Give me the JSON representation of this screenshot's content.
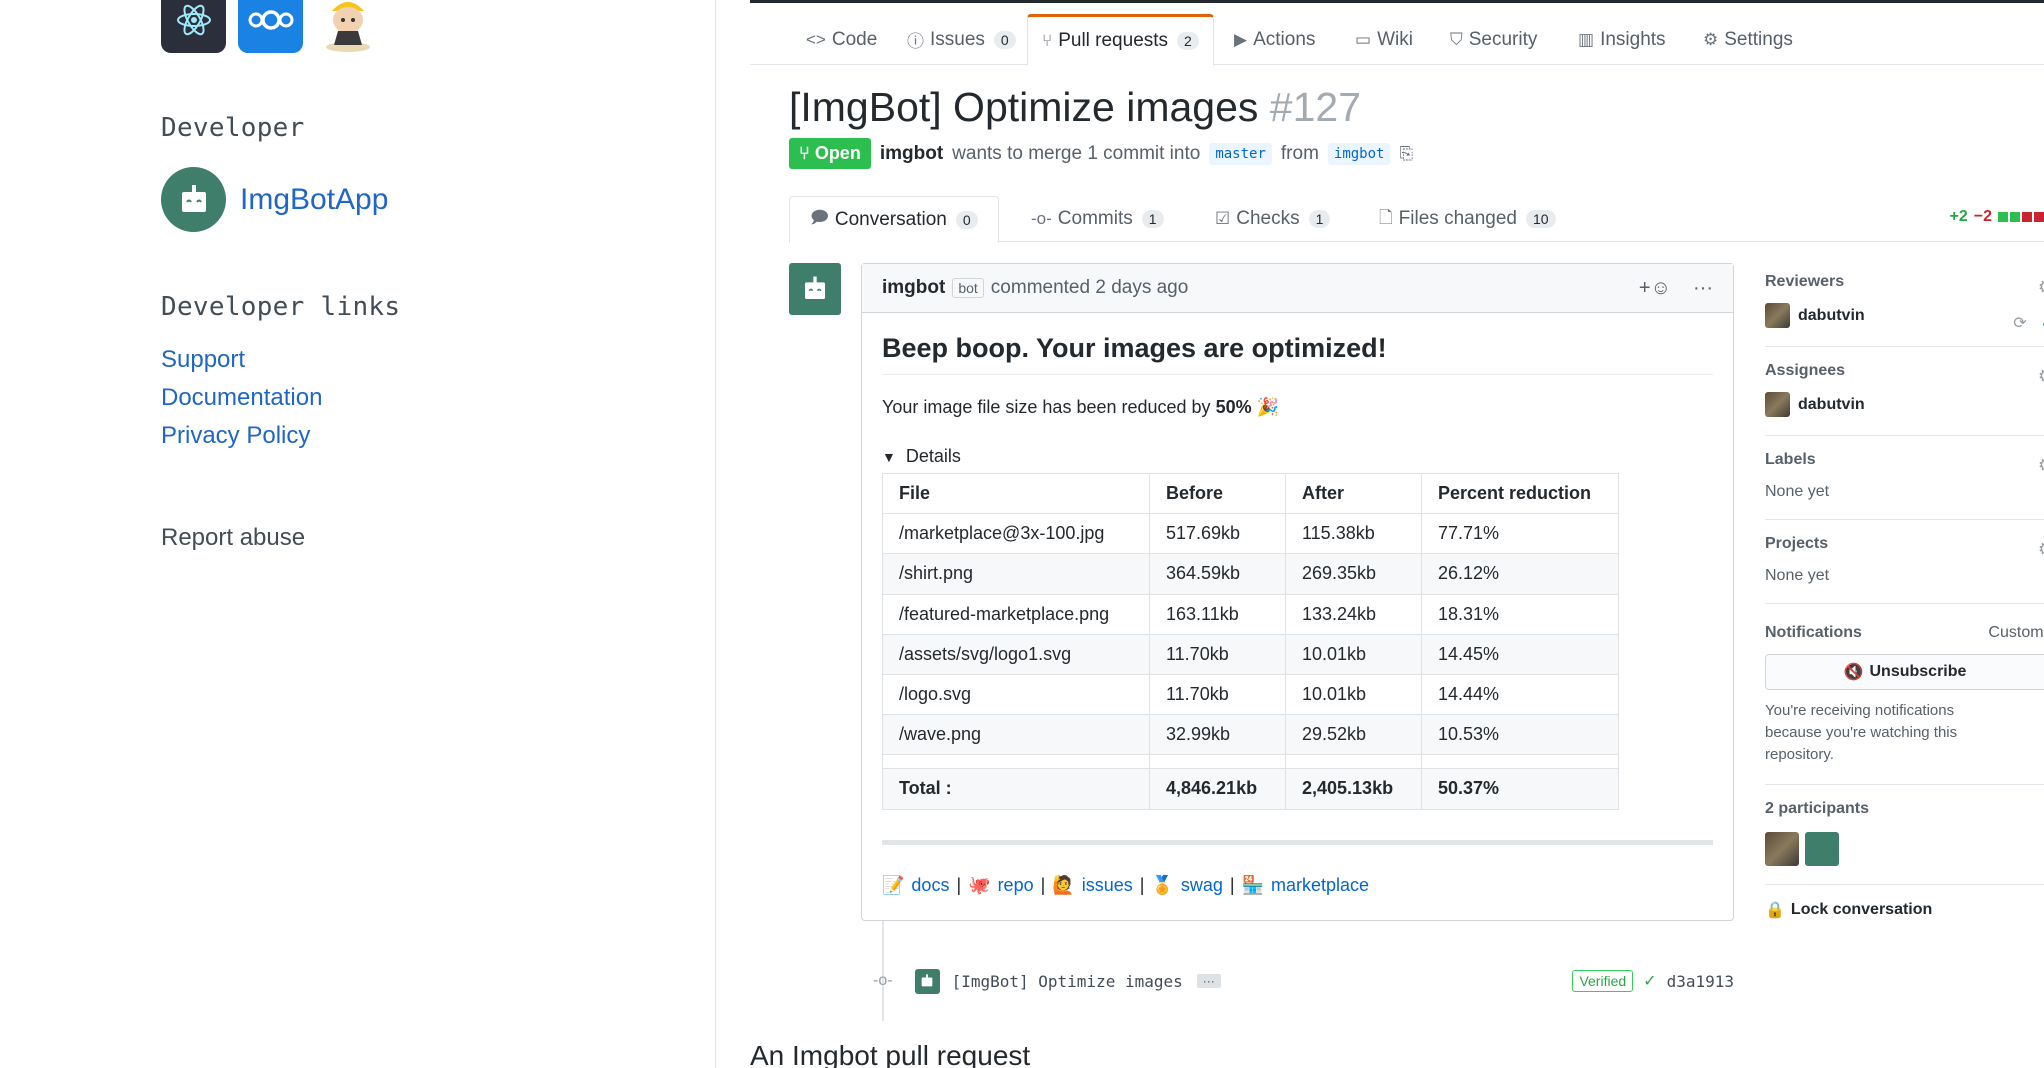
{
  "left": {
    "developer_heading": "Developer",
    "developer_name": "ImgBotApp",
    "links_heading": "Developer links",
    "links": [
      "Support",
      "Documentation",
      "Privacy Policy"
    ],
    "report": "Report abuse"
  },
  "repo_tabs": [
    {
      "label": "Code",
      "icon": "code-icon"
    },
    {
      "label": "Issues",
      "count": "0",
      "icon": "issue-icon"
    },
    {
      "label": "Pull requests",
      "count": "2",
      "icon": "pull-request-icon"
    },
    {
      "label": "Actions",
      "icon": "play-icon"
    },
    {
      "label": "Wiki",
      "icon": "book-icon"
    },
    {
      "label": "Security",
      "icon": "shield-icon"
    },
    {
      "label": "Insights",
      "icon": "graph-icon"
    },
    {
      "label": "Settings",
      "icon": "gear-icon"
    }
  ],
  "pr": {
    "title": "[ImgBot] Optimize images",
    "number": "#127",
    "state": "Open",
    "author": "imgbot",
    "merge_text": "wants to merge 1 commit into",
    "base_branch": "master",
    "from_text": "from",
    "head_branch": "imgbot"
  },
  "pr_tabs": [
    {
      "label": "Conversation",
      "count": "0"
    },
    {
      "label": "Commits",
      "count": "1"
    },
    {
      "label": "Checks",
      "count": "1"
    },
    {
      "label": "Files changed",
      "count": "10"
    }
  ],
  "diffstat": {
    "additions": "+2",
    "deletions": "−2"
  },
  "comment": {
    "author": "imgbot",
    "badge": "bot",
    "time": "commented 2 days ago",
    "heading": "Beep boop. Your images are optimized!",
    "summary_prefix": "Your image file size has been reduced by",
    "summary_value": "50%",
    "details_label": "Details",
    "table": {
      "headers": [
        "File",
        "Before",
        "After",
        "Percent reduction"
      ],
      "rows": [
        [
          "/marketplace@3x-100.jpg",
          "517.69kb",
          "115.38kb",
          "77.71%"
        ],
        [
          "/shirt.png",
          "364.59kb",
          "269.35kb",
          "26.12%"
        ],
        [
          "/featured-marketplace.png",
          "163.11kb",
          "133.24kb",
          "18.31%"
        ],
        [
          "/assets/svg/logo1.svg",
          "11.70kb",
          "10.01kb",
          "14.45%"
        ],
        [
          "/logo.svg",
          "11.70kb",
          "10.01kb",
          "14.44%"
        ],
        [
          "/wave.png",
          "32.99kb",
          "29.52kb",
          "10.53%"
        ]
      ],
      "total": [
        "Total :",
        "4,846.21kb",
        "2,405.13kb",
        "50.37%"
      ]
    },
    "footer_links": [
      "docs",
      "repo",
      "issues",
      "swag",
      "marketplace"
    ]
  },
  "commit": {
    "message": "[ImgBot] Optimize images",
    "ellipsis": "···",
    "verified": "Verified",
    "sha": "d3a1913"
  },
  "sidebar": {
    "reviewers_label": "Reviewers",
    "reviewer": "dabutvin",
    "assignees_label": "Assignees",
    "assignee": "dabutvin",
    "labels_label": "Labels",
    "labels_value": "None yet",
    "projects_label": "Projects",
    "projects_value": "None yet",
    "notifications_label": "Notifications",
    "customize": "Customize",
    "unsubscribe": "Unsubscribe",
    "notification_note": "You're receiving notifications because you're watching this repository.",
    "participants_label": "2 participants",
    "lock": "Lock conversation"
  },
  "caption": "An Imgbot pull request"
}
